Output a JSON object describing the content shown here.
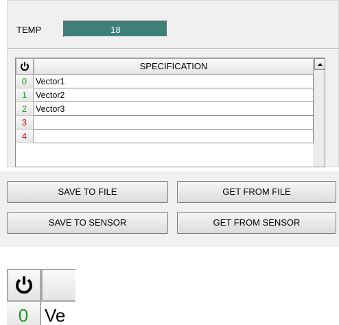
{
  "temp": {
    "label": "TEMP",
    "value": "18"
  },
  "table": {
    "power_icon": "power-icon",
    "column_header": "SPECIFICATION",
    "rows": [
      {
        "index": "0",
        "value": "Vector1"
      },
      {
        "index": "1",
        "value": "Vector2"
      },
      {
        "index": "2",
        "value": "Vector3"
      },
      {
        "index": "3",
        "value": ""
      },
      {
        "index": "4",
        "value": ""
      }
    ]
  },
  "buttons": {
    "save_to_file": "SAVE TO FILE",
    "get_from_file": "GET FROM FILE",
    "save_to_sensor": "SAVE TO SENSOR",
    "get_from_sensor": "GET FROM SENSOR"
  },
  "zoom": {
    "index": "0",
    "text": "Ve"
  },
  "colors": {
    "temp_display": "#3e7f79",
    "index_green": "#1c9a1c",
    "index_red": "#d01818"
  }
}
